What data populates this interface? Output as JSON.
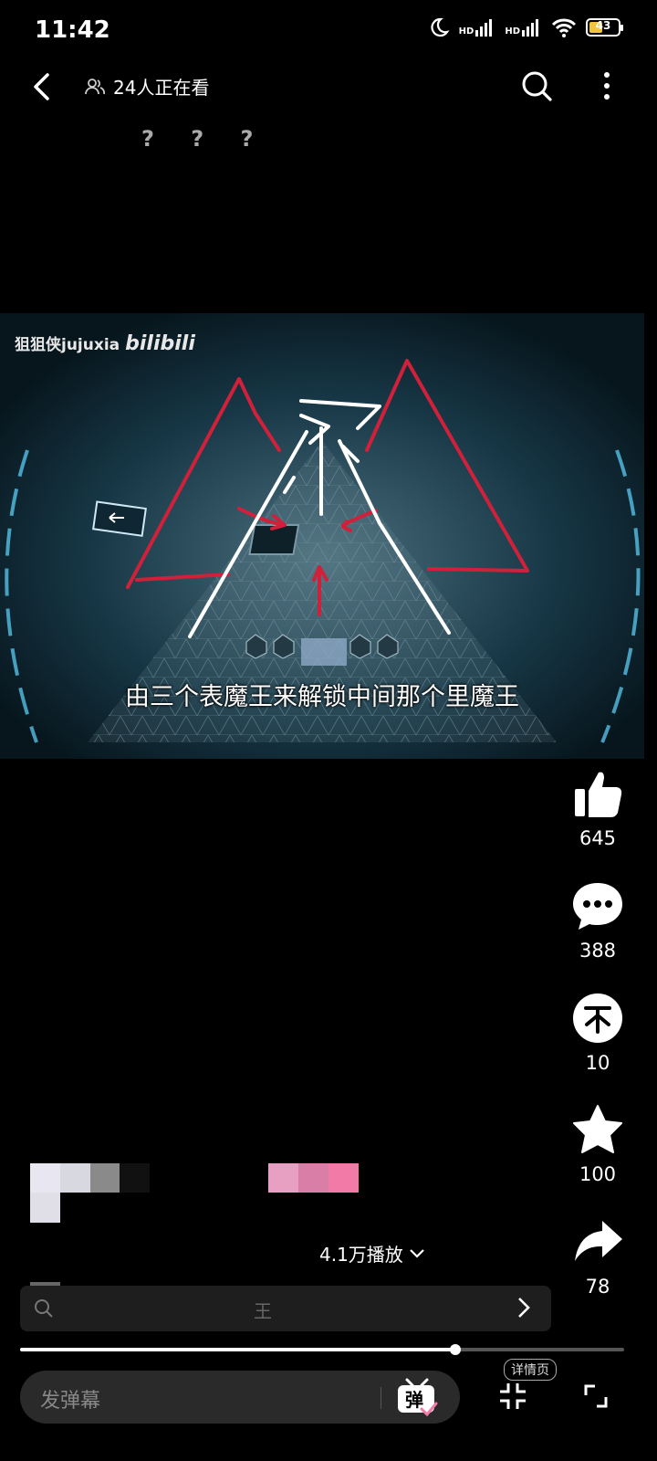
{
  "status_bar": {
    "time": "11:42",
    "battery_level": "43",
    "icons": [
      "moon-icon",
      "hd-signal-icon",
      "hd-signal-icon",
      "wifi-icon",
      "battery-icon"
    ]
  },
  "top_bar": {
    "viewers_text": "24人正在看",
    "back_icon": "chevron-left-icon",
    "search_icon": "search-icon",
    "more_icon": "more-vertical-icon"
  },
  "caption_top": "? ? ?",
  "video": {
    "watermark_user": "狙狙侠jujuxia",
    "watermark_logo": "bilibili",
    "subtitle": "由三个表魔王来解锁中间那个里魔王",
    "overlay_text": "?"
  },
  "actions": {
    "like": {
      "icon": "thumb-up-icon",
      "count": "645"
    },
    "comment": {
      "icon": "comment-icon",
      "count": "388"
    },
    "coin": {
      "icon": "coin-icon",
      "count": "10"
    },
    "favorite": {
      "icon": "star-icon",
      "count": "100"
    },
    "share": {
      "icon": "share-icon",
      "count": "78"
    }
  },
  "video_info": {
    "plays": "4.1万播放",
    "search_query": "王"
  },
  "playback": {
    "progress_fraction": 0.72
  },
  "bottom_bar": {
    "danmaku_placeholder": "发弹幕",
    "danmaku_button": "弹",
    "detail_label": "详情页"
  },
  "colors": {
    "background": "#000000",
    "battery_fill": "#f0c43c",
    "annotation_red": "#d0203a",
    "accent_pink": "#f27aa6"
  }
}
